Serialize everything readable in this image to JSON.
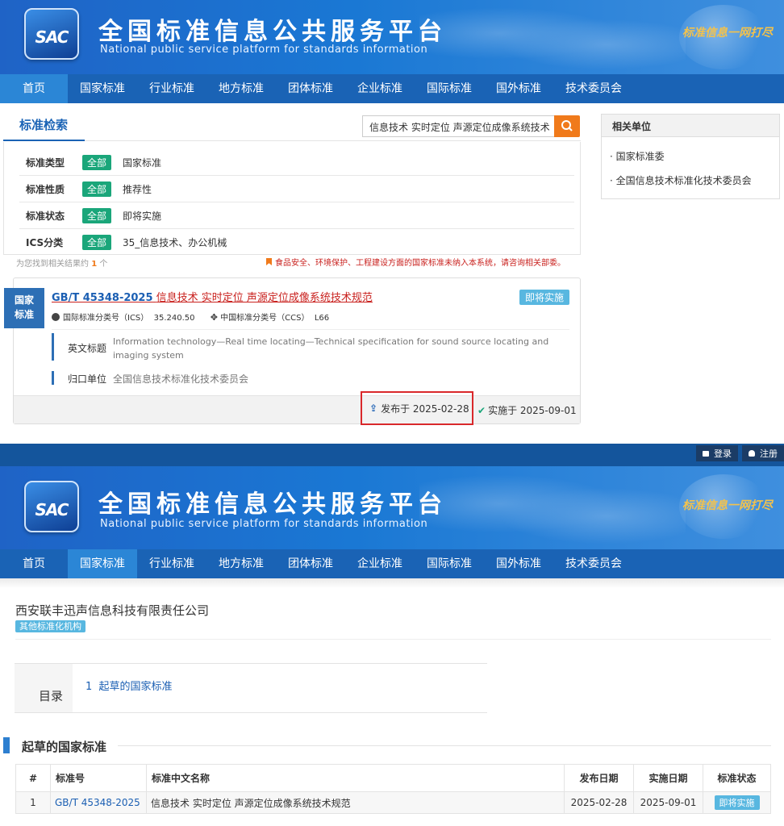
{
  "brand": {
    "logo": "SAC",
    "title_cn": "全国标准信息公共服务平台",
    "title_en": "National public service platform  for standards information",
    "slogan": "标准信息一网打尽"
  },
  "nav": [
    "首页",
    "国家标准",
    "行业标准",
    "地方标准",
    "团体标准",
    "企业标准",
    "国际标准",
    "国外标准",
    "技术委员会"
  ],
  "search": {
    "tab": "标准检索",
    "query": "信息技术 实时定位 声源定位成像系统技术"
  },
  "filters": [
    {
      "label": "标准类型",
      "tag": "全部",
      "value": "国家标准"
    },
    {
      "label": "标准性质",
      "tag": "全部",
      "value": "推荐性"
    },
    {
      "label": "标准状态",
      "tag": "全部",
      "value": "即将实施"
    },
    {
      "label": "ICS分类",
      "tag": "全部",
      "value": "35_信息技术、办公机械"
    }
  ],
  "results_found": {
    "prefix": "为您找到相关结果约",
    "count": "1",
    "suffix": "个"
  },
  "notice": "食品安全、环境保护、工程建设方面的国家标准未纳入本系统，请咨询相关部委。",
  "result": {
    "side_tag_1": "国家",
    "side_tag_2": "标准",
    "code": "GB/T 45348-2025",
    "title": "信息技术 实时定位 声源定位成像系统技术规范",
    "status": "即将实施",
    "ics_label": "国际标准分类号（ICS）",
    "ics": "35.240.50",
    "ccs_label": "中国标准分类号（CCS）",
    "ccs": "L66",
    "en_label": "英文标题",
    "en_title": "Information technology—Real time locating—Technical specification for sound source locating and imaging system",
    "org_label": "归口单位",
    "org": "全国信息技术标准化技术委员会",
    "published": "发布于 2025-02-28",
    "implemented": "实施于 2025-09-01"
  },
  "related": {
    "title": "相关单位",
    "items": [
      "· 国家标准委",
      "· 全国信息技术标准化技术委员会"
    ]
  },
  "topbar": {
    "login": "登录",
    "register": "注册"
  },
  "company": {
    "name": "西安联丰迅声信息科技有限责任公司",
    "tag": "其他标准化机构"
  },
  "toc": {
    "label": "目录",
    "item": "1  起草的国家标准"
  },
  "section_title": "起草的国家标准",
  "table": {
    "headers": [
      "#",
      "标准号",
      "标准中文名称",
      "发布日期",
      "实施日期",
      "标准状态"
    ],
    "rows": [
      [
        "1",
        "GB/T 45348-2025",
        "信息技术 实时定位 声源定位成像系统技术规范",
        "2025-02-28",
        "2025-09-01",
        "即将实施"
      ]
    ]
  },
  "colors": {
    "header_blue": "#1a63b5",
    "nav_active": "#2b86d6",
    "green": "#1aa67a",
    "orange": "#f07a1b",
    "link": "#1b5fb3",
    "title_red": "#c9211e",
    "highlight_border": "#d9282b"
  }
}
